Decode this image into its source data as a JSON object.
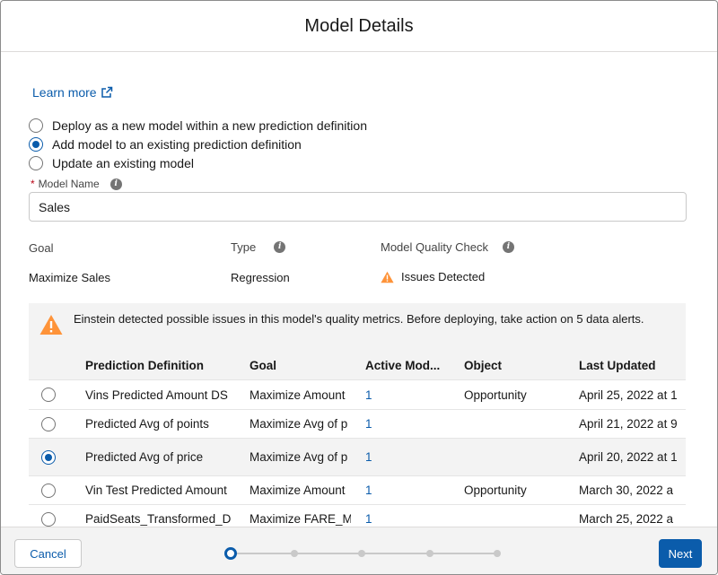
{
  "modal": {
    "title": "Model Details"
  },
  "learn_more": {
    "label": "Learn more",
    "icon": "external-link-icon"
  },
  "deploy_options": [
    {
      "label": "Deploy as a new model within a new prediction definition",
      "checked": false
    },
    {
      "label": "Add model to an existing prediction definition",
      "checked": true
    },
    {
      "label": "Update an existing model",
      "checked": false
    }
  ],
  "model_name": {
    "required_mark": "*",
    "label": "Model Name",
    "value": "Sales",
    "icon": "info-icon"
  },
  "meta": {
    "goal_label": "Goal",
    "goal_value": "Maximize Sales",
    "type_label": "Type",
    "type_value": "Regression",
    "quality_label": "Model Quality Check",
    "quality_value": "Issues Detected"
  },
  "alert": {
    "text": "Einstein detected possible issues in this model's quality metrics. Before deploying, take action on 5 data alerts.",
    "icon": "warning-icon",
    "color": "#fe9339"
  },
  "table": {
    "columns": [
      "Prediction Definition",
      "Goal",
      "Active Mod...",
      "Object",
      "Last Updated"
    ],
    "rows": [
      {
        "definition": "Vins Predicted Amount DS",
        "goal": "Maximize Amount",
        "active": "1",
        "object": "Opportunity",
        "updated": "April 25, 2022 at 1",
        "selected": false
      },
      {
        "definition": "Predicted Avg of points",
        "goal": "Maximize Avg of p",
        "active": "1",
        "object": "",
        "updated": "April 21, 2022 at 9",
        "selected": false
      },
      {
        "definition": "Predicted Avg of price",
        "goal": "Maximize Avg of p",
        "active": "1",
        "object": "",
        "updated": "April 20, 2022 at 1",
        "selected": true
      },
      {
        "definition": "Vin Test Predicted Amount",
        "goal": "Maximize Amount",
        "active": "1",
        "object": "Opportunity",
        "updated": "March 30, 2022 a",
        "selected": false
      },
      {
        "definition": "PaidSeats_Transformed_D",
        "goal": "Maximize FARE_M",
        "active": "1",
        "object": "",
        "updated": "March 25, 2022 a",
        "selected": false
      }
    ]
  },
  "footer": {
    "cancel_label": "Cancel",
    "next_label": "Next",
    "steps_total": 5,
    "current_step": 1
  },
  "colors": {
    "brand": "#0b5cab",
    "warning": "#fe9339"
  }
}
